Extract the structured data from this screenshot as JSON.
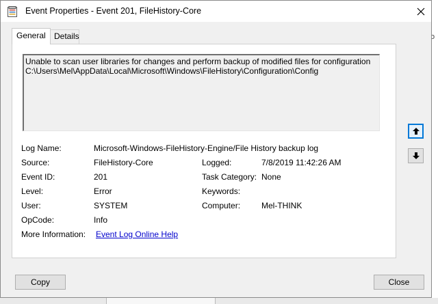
{
  "window": {
    "title": "Event Properties - Event 201, FileHistory-Core"
  },
  "tabs": [
    {
      "label": "General",
      "active": true
    },
    {
      "label": "Details",
      "active": false
    }
  ],
  "general": {
    "message": "Unable to scan user libraries for changes and perform backup of modified files for configuration\nC:\\Users\\Mel\\AppData\\Local\\Microsoft\\Windows\\FileHistory\\Configuration\\Config",
    "fields": {
      "log_name": {
        "label": "Log Name:",
        "value": "Microsoft-Windows-FileHistory-Engine/File History backup log"
      },
      "source": {
        "label": "Source:",
        "value": "FileHistory-Core"
      },
      "logged": {
        "label": "Logged:",
        "value": "7/8/2019 11:42:26 AM"
      },
      "event_id": {
        "label": "Event ID:",
        "value": "201"
      },
      "task_category": {
        "label": "Task Category:",
        "value": "None"
      },
      "level": {
        "label": "Level:",
        "value": "Error"
      },
      "keywords": {
        "label": "Keywords:",
        "value": ""
      },
      "user": {
        "label": "User:",
        "value": "SYSTEM"
      },
      "computer": {
        "label": "Computer:",
        "value": "Mel-THINK"
      },
      "opcode": {
        "label": "OpCode:",
        "value": "Info"
      },
      "more_info": {
        "label": "More Information:",
        "link": "Event Log Online Help"
      }
    }
  },
  "buttons": {
    "copy": "Copy",
    "close": "Close"
  },
  "background": {
    "right_edge_text": "o"
  },
  "colors": {
    "focus_accent": "#0078d7",
    "link": "#0000cc"
  }
}
